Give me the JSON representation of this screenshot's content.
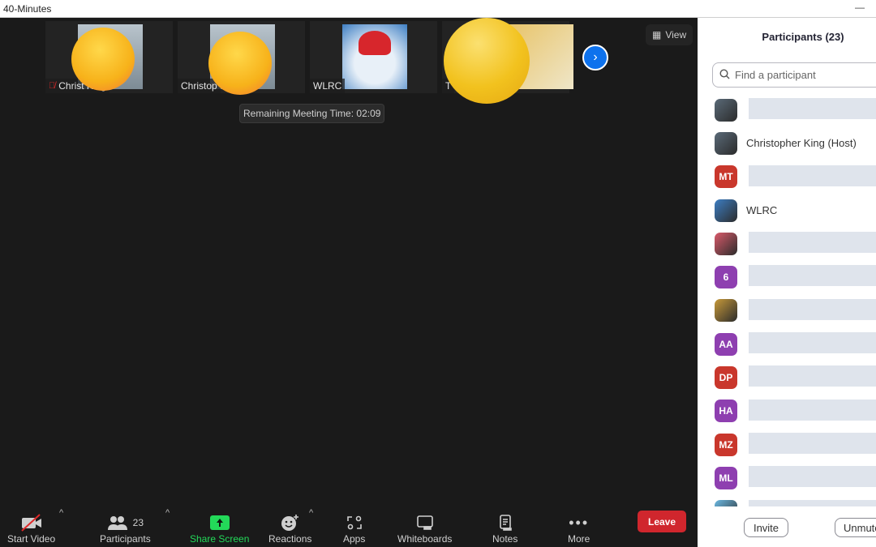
{
  "window": {
    "title": "40-Minutes",
    "minimize_glyph": "—"
  },
  "meeting": {
    "gallery": [
      {
        "name": "Christopher King",
        "shown_name": "Christ    King",
        "muted": true,
        "avatar": "photo",
        "overlay_emoji": "unamused-face"
      },
      {
        "name": "Christopher King",
        "shown_name": "Christop",
        "muted": false,
        "avatar": "photo",
        "overlay_emoji": "unamused-face"
      },
      {
        "name": "WLRC",
        "shown_name": "WLRC",
        "muted": false,
        "avatar": "cartoon",
        "overlay_emoji": null
      },
      {
        "name": "T",
        "shown_name": "T",
        "muted": false,
        "avatar": "photo",
        "overlay_emoji": "smiling-face"
      }
    ],
    "next_page_icon": "chevron-right-icon",
    "view_button": {
      "label": "View",
      "icon": "grid-icon"
    },
    "remaining_time_label": "Remaining Meeting Time: 02:09"
  },
  "toolbar": {
    "start_video": {
      "label": "Start Video",
      "icon": "video-off-icon"
    },
    "participants": {
      "label": "Participants",
      "count": "23",
      "icon": "people-icon"
    },
    "share_screen": {
      "label": "Share Screen",
      "icon": "share-up-arrow-icon",
      "color": "#23d959"
    },
    "reactions": {
      "label": "Reactions",
      "icon": "smiley-plus-icon"
    },
    "apps": {
      "label": "Apps",
      "icon": "apps-icon"
    },
    "whiteboards": {
      "label": "Whiteboards",
      "icon": "whiteboard-icon"
    },
    "notes": {
      "label": "Notes",
      "icon": "notes-icon"
    },
    "more": {
      "label": "More",
      "icon": "ellipsis-icon"
    },
    "leave": {
      "label": "Leave",
      "color": "#d0262d"
    },
    "caret": "^"
  },
  "panel": {
    "title": "Participants (23)",
    "search_placeholder": "Find a participant",
    "participants": [
      {
        "initials": "",
        "avatar_type": "photo",
        "color": "#5a6a78",
        "name": "",
        "redacted": true
      },
      {
        "initials": "",
        "avatar_type": "photo",
        "color": "#5a6a78",
        "name": "Christopher King (Host)",
        "redacted": false
      },
      {
        "initials": "MT",
        "avatar_type": "initials",
        "color": "#c9372c",
        "name": "",
        "redacted": true
      },
      {
        "initials": "",
        "avatar_type": "cartoon",
        "color": "#3d7ec3",
        "name": "WLRC",
        "redacted": false
      },
      {
        "initials": "",
        "avatar_type": "photo",
        "color": "#d95a6a",
        "name": "",
        "redacted": true
      },
      {
        "initials": "6",
        "avatar_type": "initials",
        "color": "#8e3fb0",
        "name": "",
        "redacted": true
      },
      {
        "initials": "",
        "avatar_type": "photo",
        "color": "#c79a3a",
        "name": "",
        "redacted": true
      },
      {
        "initials": "AA",
        "avatar_type": "initials",
        "color": "#8e3fb0",
        "name": "",
        "redacted": true
      },
      {
        "initials": "DP",
        "avatar_type": "initials",
        "color": "#c9372c",
        "name": "",
        "redacted": true
      },
      {
        "initials": "HA",
        "avatar_type": "initials",
        "color": "#8e3fb0",
        "name": "",
        "redacted": true
      },
      {
        "initials": "MZ",
        "avatar_type": "initials",
        "color": "#c9372c",
        "name": "",
        "redacted": true
      },
      {
        "initials": "ML",
        "avatar_type": "initials",
        "color": "#8e3fb0",
        "name": "",
        "redacted": true
      },
      {
        "initials": "",
        "avatar_type": "photo",
        "color": "#6ab7e0",
        "name": "",
        "redacted": true
      }
    ],
    "invite_label": "Invite",
    "unmute_label": "Unmute All"
  }
}
